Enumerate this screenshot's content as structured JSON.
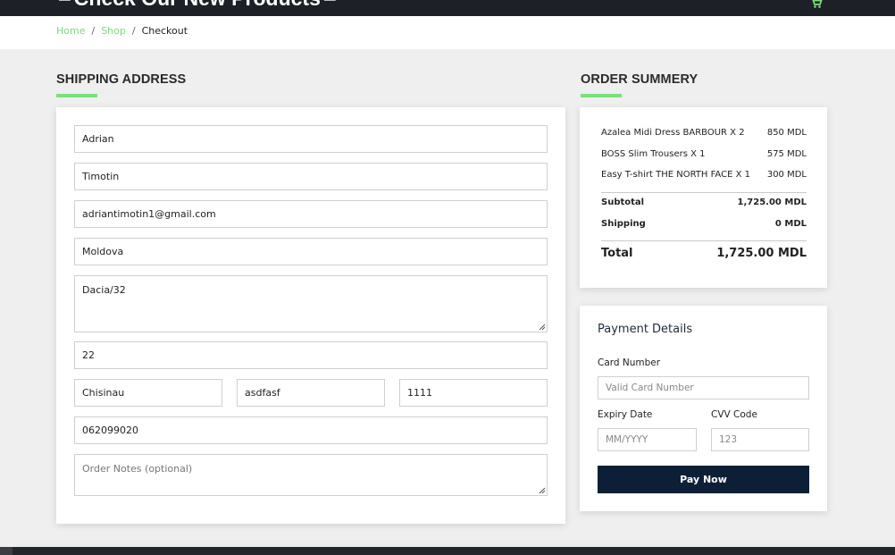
{
  "header": {
    "hero_title": "Check Our New Products",
    "cart_icon": "cart-icon",
    "accent_color": "#7be07b"
  },
  "breadcrumb": {
    "home": "Home",
    "shop": "Shop",
    "current": "Checkout",
    "separator": "/"
  },
  "shipping": {
    "title": "SHIPPING ADDRESS",
    "first_name": "Adrian",
    "last_name": "Timotin",
    "email": "adriantimotin1@gmail.com",
    "country": "Moldova",
    "address": "Dacia/32",
    "apartment": "22",
    "city": "Chisinau",
    "state": "asdfasf",
    "zip": "1111",
    "phone": "062099020",
    "notes_placeholder": "Order Notes (optional)"
  },
  "summary": {
    "title": "ORDER SUMMERY",
    "items": [
      {
        "name": "Azalea Midi Dress BARBOUR X 2",
        "price": "850 MDL"
      },
      {
        "name": "BOSS Slim Trousers X 1",
        "price": "575 MDL"
      },
      {
        "name": "Easy T-shirt THE NORTH FACE X 1",
        "price": "300 MDL"
      }
    ],
    "subtotal_label": "Subtotal",
    "subtotal_value": "1,725.00 MDL",
    "shipping_label": "Shipping",
    "shipping_value": "0 MDL",
    "total_label": "Total",
    "total_value": "1,725.00 MDL"
  },
  "payment": {
    "heading": "Payment Details",
    "card_number_label": "Card Number",
    "card_number_placeholder": "Valid Card Number",
    "expiry_label": "Expiry Date",
    "expiry_placeholder": "MM/YYYY",
    "cvv_label": "CVV Code",
    "cvv_placeholder": "123",
    "pay_button": "Pay Now",
    "button_color": "#0d1f36"
  }
}
